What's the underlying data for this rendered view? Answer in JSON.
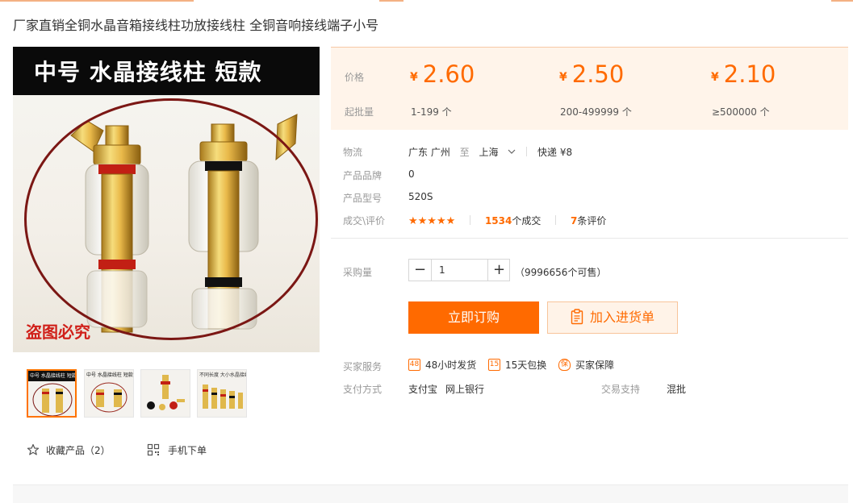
{
  "product": {
    "title": "厂家直销全铜水晶音箱接线柱功放接线柱 全铜音响接线端子小号"
  },
  "main_image": {
    "banner_text": "中号 水晶接线柱  短款",
    "watermark": "盗图必究"
  },
  "thumbnails": [
    {
      "caption": "中号 水晶接线柱 短款",
      "selected": true
    },
    {
      "caption": "中号 水晶接线柱 短款",
      "selected": false
    },
    {
      "caption": "",
      "selected": false
    },
    {
      "caption": "不同长度 大小水晶接线柱",
      "selected": false
    }
  ],
  "actions": {
    "favorite_label": "收藏产品（2）",
    "mobile_order_label": "手机下单"
  },
  "pricing": {
    "price_label": "价格",
    "moq_label": "起批量",
    "currency": "¥",
    "tiers": [
      {
        "price": "2.60",
        "range": "1-199 个"
      },
      {
        "price": "2.50",
        "range": "200-499999 个"
      },
      {
        "price": "2.10",
        "range": "≥500000 个"
      }
    ]
  },
  "logistics": {
    "label": "物流",
    "from": "广东 广州",
    "to_word": "至",
    "destination": "上海",
    "shipping": "快递 ¥8"
  },
  "brand": {
    "label": "产品品牌",
    "value": "0"
  },
  "model": {
    "label": "产品型号",
    "value": "520S"
  },
  "deals": {
    "label": "成交\\评价",
    "stars": "★★★★★",
    "rating": 5,
    "deal_count": "1534",
    "deal_suffix": "个成交",
    "review_count": "7",
    "review_suffix": "条评价"
  },
  "purchase": {
    "qty_label": "采购量",
    "minus": "−",
    "plus": "+",
    "quantity": "1",
    "stock_text": "（9996656个可售）",
    "buy_now": "立即订购",
    "add_to_list": "加入进货单"
  },
  "services": {
    "label": "买家服务",
    "items": [
      {
        "icon": "48-hour-shipping-icon",
        "glyph": "48",
        "label": "48小时发货"
      },
      {
        "icon": "15-day-exchange-icon",
        "glyph": "15",
        "label": "15天包换"
      },
      {
        "icon": "buyer-protection-icon",
        "glyph": "保",
        "label": "买家保障"
      }
    ]
  },
  "payment": {
    "label": "支付方式",
    "methods": [
      "支付宝",
      "网上银行"
    ],
    "trade_label": "交易支持",
    "trade_value": "混批"
  },
  "colors": {
    "accent": "#ff6a00",
    "price_bg": "#fff4ea",
    "frame_circle": "#7b1714"
  }
}
